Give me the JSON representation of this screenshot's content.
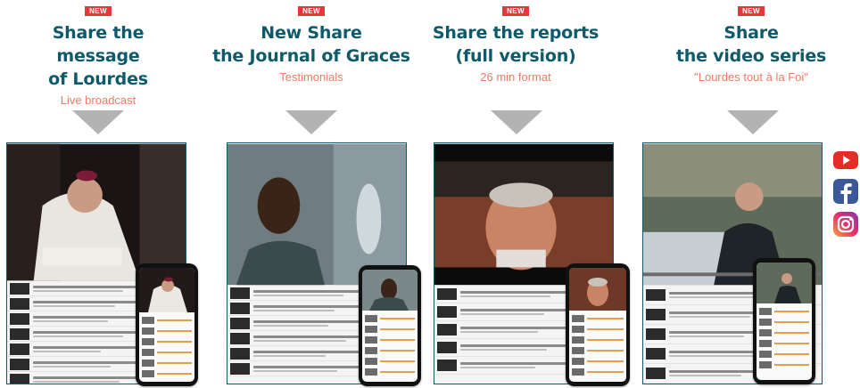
{
  "columns": [
    {
      "badge": "NEW",
      "title_line1": "Share the message",
      "title_line2": "of Lourdes",
      "subtitle": "Live broadcast"
    },
    {
      "badge": "NEW",
      "title_line1": "New Share",
      "title_line2": "the Journal of Graces",
      "subtitle": "Testimonials"
    },
    {
      "badge": "NEW",
      "title_line1": "Share the reports",
      "title_line2": "(full version)",
      "subtitle": "26 min format"
    },
    {
      "badge": "NEW",
      "title_line1": "Share",
      "title_line2": "the video series",
      "subtitle": "\"Lourdes tout à la Foi\""
    }
  ],
  "social": [
    "youtube-icon",
    "facebook-icon",
    "instagram-icon"
  ],
  "colors": {
    "title": "#0e5a6b",
    "subtitle": "#f07a63",
    "badge": "#e5383b",
    "arrow": "#b3b3b3"
  }
}
